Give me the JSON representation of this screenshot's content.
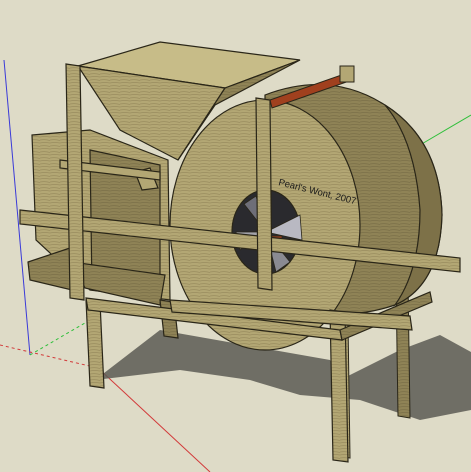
{
  "scene": {
    "model_label": "Pearl's Wont, 2007",
    "axis_colors": {
      "red": "#d23a3a",
      "green": "#2fbf3a",
      "blue": "#3a3ad8"
    },
    "colors": {
      "background": "#dedbc7",
      "wood_light": "#b9ad7a",
      "wood_mid": "#a09260",
      "wood_dark": "#7d7148",
      "edge": "#2a2618",
      "shadow": "#5c5a54",
      "metal": "#9a9aa0",
      "rope": "#a0401e"
    }
  }
}
